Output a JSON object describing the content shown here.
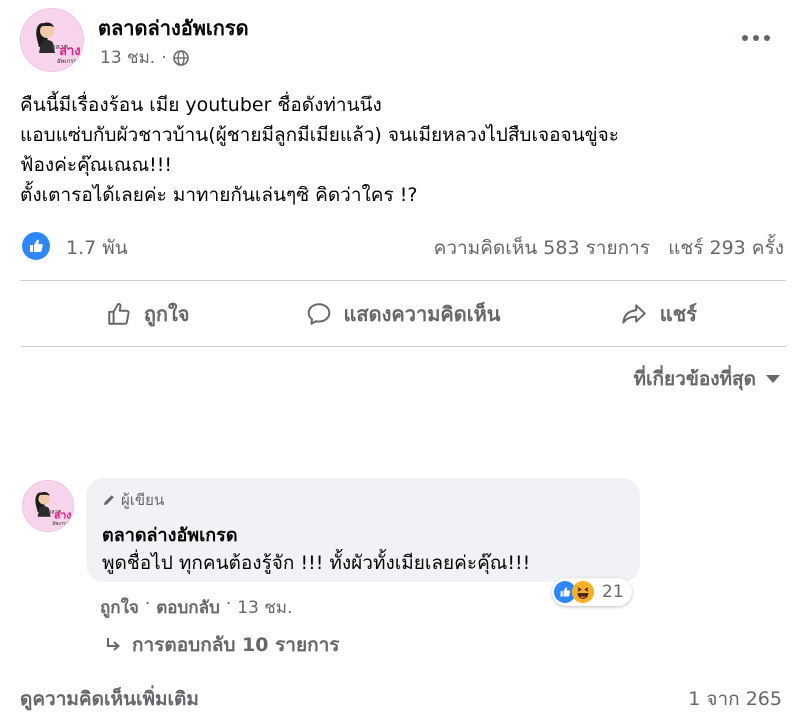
{
  "post": {
    "page_name": "ตลาดล่างอัพเกรด",
    "time": "13 ชม.",
    "privacy_icon": "globe-icon",
    "more_icon": "more-horizontal-icon",
    "text_lines": [
      "คืนนี้มีเรื่องร้อน เมีย youtuber ชื่อดังท่านนึง",
      "แอบแซ่บกับผัวชาวบ้าน(ผู้ชายมีลูกมีเมียแล้ว) จนเมียหลวงไปสืบเจอจนขู่จะ",
      "ฟ้องค่ะคุ๊ณเณณ!!!",
      "ตั้งเตารอได้เลยค่ะ มาทายกันเล่นๆซิ คิดว่าใคร !?"
    ]
  },
  "stats": {
    "reaction_count": "1.7 พัน",
    "comments": "ความคิดเห็น 583 รายการ",
    "shares": "แชร์ 293 ครั้ง"
  },
  "actions": {
    "like": "ถูกใจ",
    "comment": "แสดงความคิดเห็น",
    "share": "แชร์"
  },
  "sort": {
    "label": "ที่เกี่ยวข้องที่สุด"
  },
  "comment": {
    "author_badge": "ผู้เขียน",
    "name": "ตลาดล่างอัพเกรด",
    "text": "พูดชื่อไป ทุกคนต้องรู้จัก !!! ทั้งผัวทั้งเมียเลยค่ะคุ๊ณ!!!",
    "reaction_count": "21",
    "like": "ถูกใจ",
    "reply": "ตอบกลับ",
    "time": "13 ชม.",
    "separator": "·",
    "replies": "การตอบกลับ 10 รายการ"
  },
  "footer": {
    "more_comments": "ดูความคิดเห็นเพิ่มเติม",
    "pagination": "1 จาก 265"
  },
  "logo_text": {
    "line1": "ตลาด",
    "line2": "ล่าง",
    "line3": "อัพเกรด"
  },
  "colors": {
    "facebook_blue": "#2d88ff",
    "secondary_text": "#65676b",
    "bubble_bg": "#f0f2f5",
    "avatar_pink": "#f7d3ec"
  }
}
